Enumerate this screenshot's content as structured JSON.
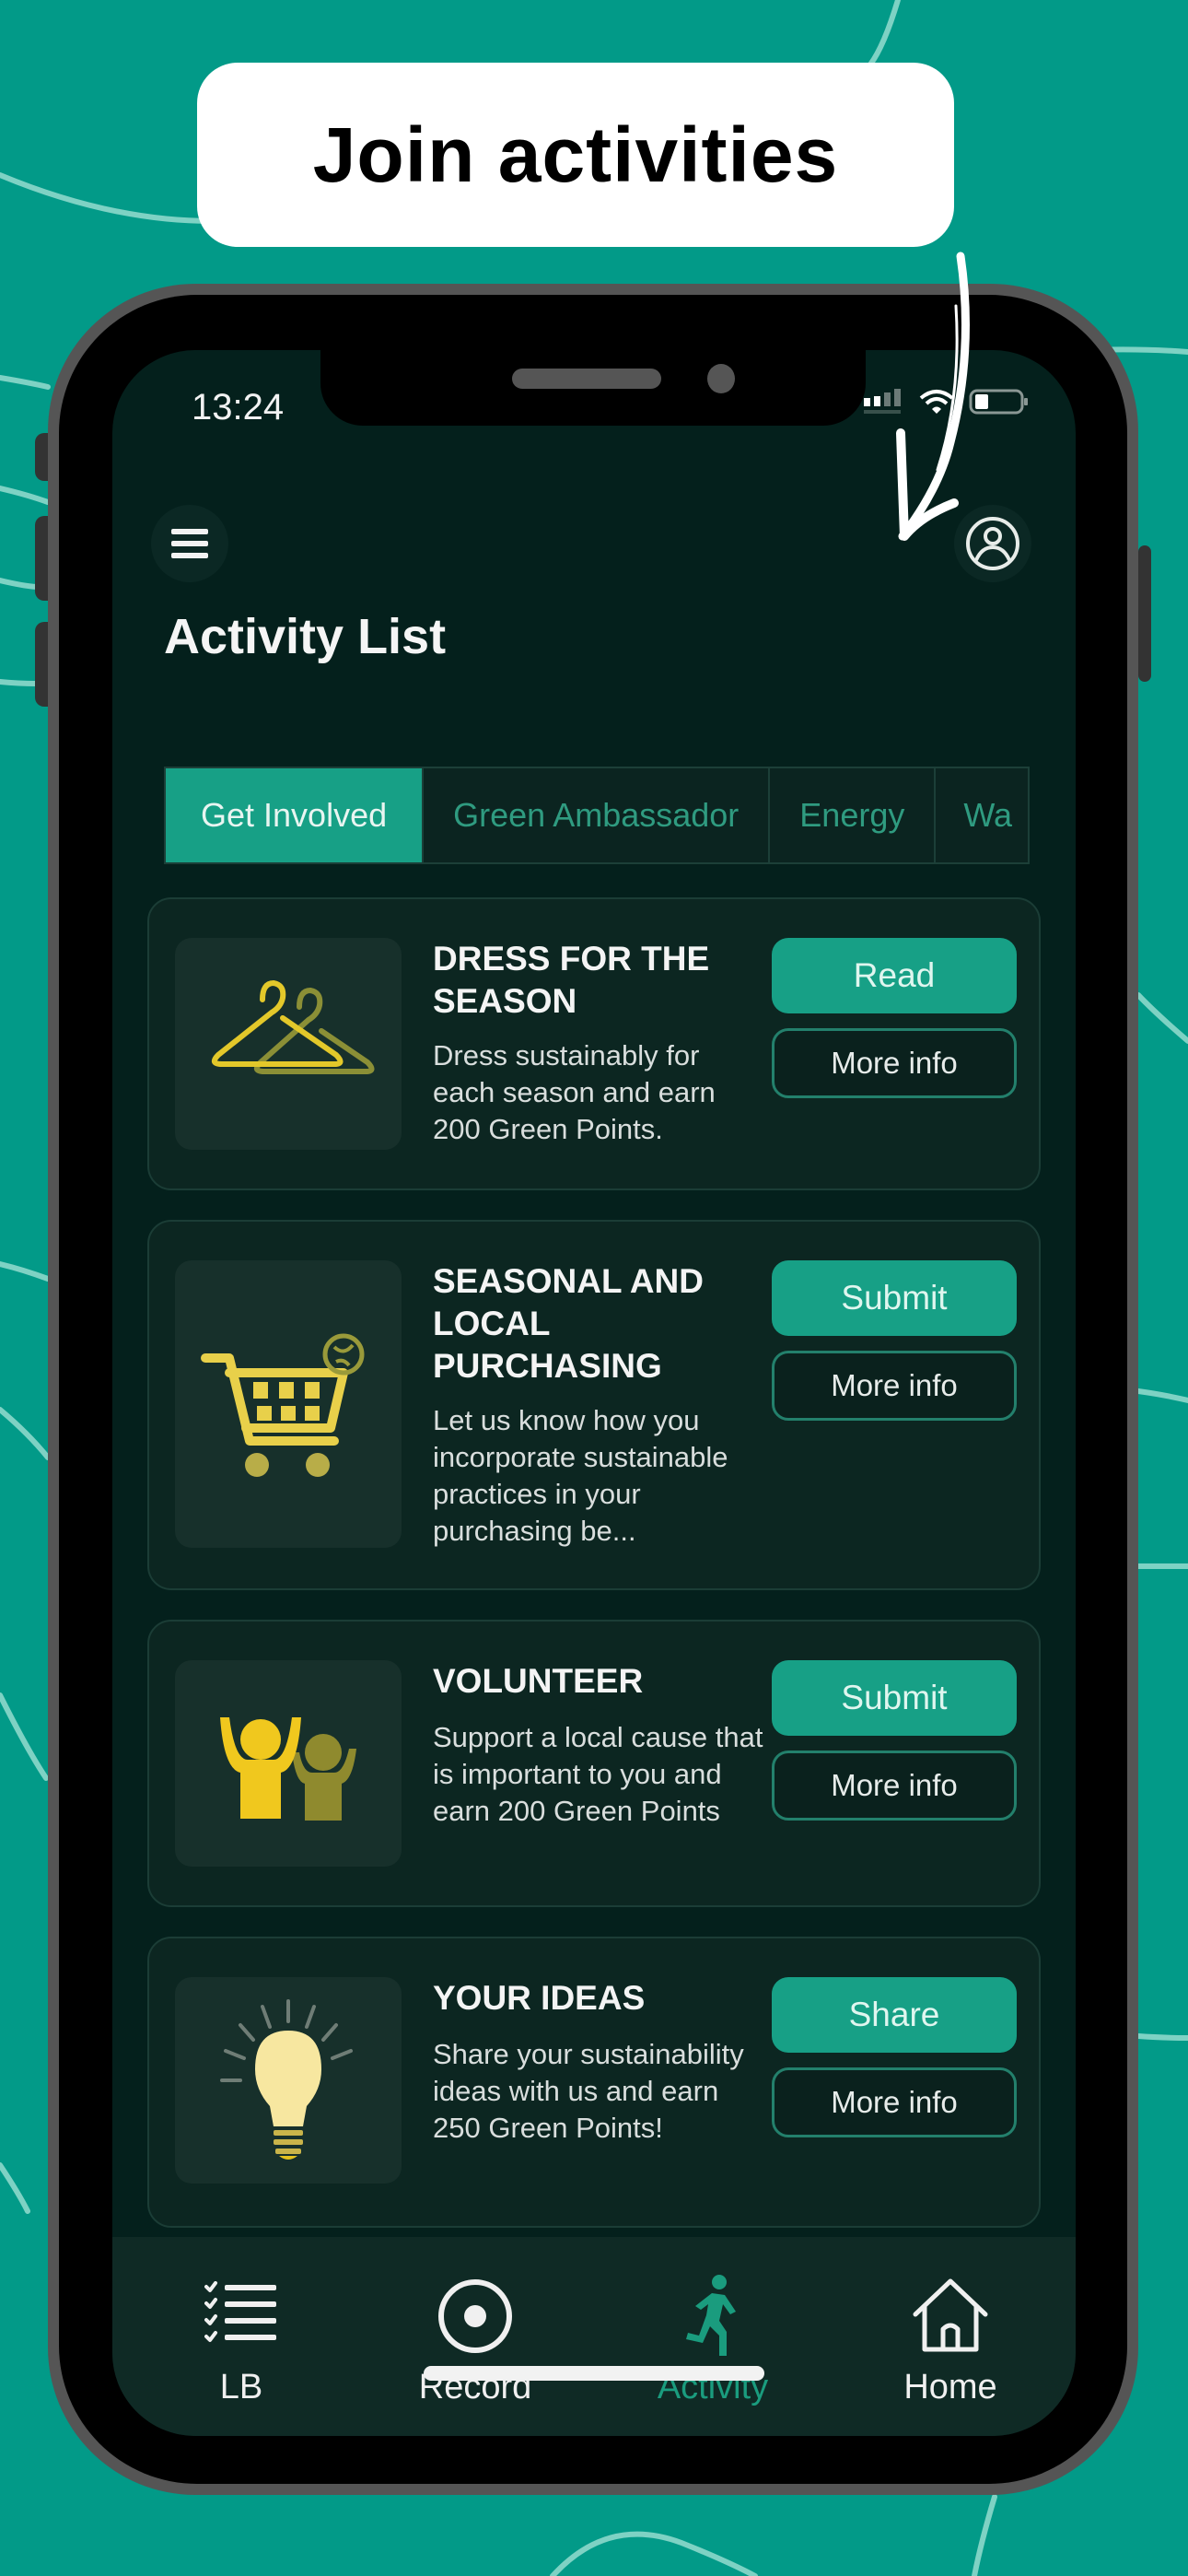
{
  "callout": {
    "text": "Join activities"
  },
  "colors": {
    "background": "#029a88",
    "accent": "#17a086",
    "screen": "#04201c",
    "icon_yellow": "#e8cf2a"
  },
  "status_bar": {
    "time": "13:24",
    "icons": [
      "signal-icon",
      "wifi-icon",
      "battery-icon"
    ]
  },
  "header": {
    "menu_icon": "hamburger-menu-icon",
    "profile_icon": "user-profile-icon",
    "title": "Activity List"
  },
  "category_tabs": [
    {
      "label": "Get Involved",
      "active": true
    },
    {
      "label": "Green Ambassador",
      "active": false
    },
    {
      "label": "Energy",
      "active": false
    },
    {
      "label": "Wa",
      "active": false
    }
  ],
  "activities": [
    {
      "icon": "clothes-hanger-icon",
      "title": "DRESS FOR THE SEASON",
      "description": "Dress sustainably for each season and earn 200 Green Points.",
      "primary_action": "Read",
      "secondary_action": "More info"
    },
    {
      "icon": "shopping-cart-globe-icon",
      "title": "SEASONAL AND LOCAL PURCHASING",
      "description": "Let us know how you incorporate sustainable practices in your purchasing be...",
      "primary_action": "Submit",
      "secondary_action": "More info"
    },
    {
      "icon": "volunteers-icon",
      "title": "VOLUNTEER",
      "description": "Support a local cause that is important to you and earn 200 Green Points",
      "primary_action": "Submit",
      "secondary_action": "More info"
    },
    {
      "icon": "lightbulb-icon",
      "title": "YOUR IDEAS",
      "description": "Share your sustainability ideas with us and earn 250 Green Points!",
      "primary_action": "Share",
      "secondary_action": "More info"
    }
  ],
  "bottom_nav": [
    {
      "label": "LB",
      "icon": "checklist-icon",
      "active": false
    },
    {
      "label": "Record",
      "icon": "record-icon",
      "active": false
    },
    {
      "label": "Activity",
      "icon": "running-person-icon",
      "active": true
    },
    {
      "label": "Home",
      "icon": "home-icon",
      "active": false
    }
  ]
}
